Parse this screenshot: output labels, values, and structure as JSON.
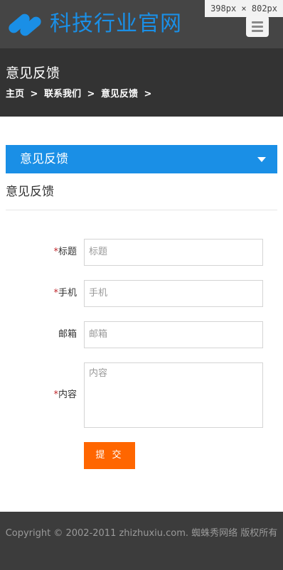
{
  "header": {
    "site_title": "科技行业官网",
    "menu_icon": "hamburger-menu-icon",
    "logo_icon": "s-shape-logo-icon",
    "size_badge": "398px × 802px"
  },
  "banner": {
    "title": "意见反馈",
    "breadcrumb": [
      "主页",
      ">",
      "联系我们",
      ">",
      "意见反馈",
      ">"
    ]
  },
  "section": {
    "bar_label": "意见反馈",
    "heading": "意见反馈"
  },
  "form": {
    "required_mark": "*",
    "fields": [
      {
        "label": "标题",
        "placeholder": "标题",
        "required": true
      },
      {
        "label": "手机",
        "placeholder": "手机",
        "required": true
      },
      {
        "label": "邮箱",
        "placeholder": "邮箱",
        "required": false
      },
      {
        "label": "内容",
        "placeholder": "内容",
        "required": true
      }
    ],
    "submit_label": "提 交"
  },
  "footer": {
    "copyright": "Copyright © 2002-2011 zhizhuxiu.com. 蜘蛛秀网络 版权所有"
  },
  "colors": {
    "brand_blue": "#1a8fe6",
    "submit_orange": "#ff6600",
    "required_red": "#c0282d",
    "header_dark": "#454545",
    "banner_dark": "#333333",
    "footer_dark": "#3c3c3c"
  }
}
